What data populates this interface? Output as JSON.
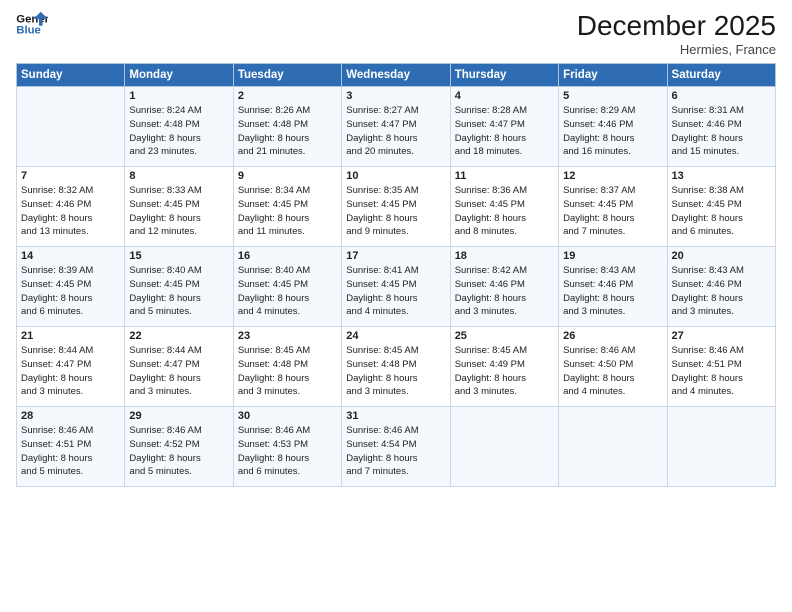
{
  "header": {
    "logo_line1": "General",
    "logo_line2": "Blue",
    "month": "December 2025",
    "location": "Hermies, France"
  },
  "columns": [
    "Sunday",
    "Monday",
    "Tuesday",
    "Wednesday",
    "Thursday",
    "Friday",
    "Saturday"
  ],
  "weeks": [
    [
      {
        "day": "",
        "sunrise": "",
        "sunset": "",
        "daylight": ""
      },
      {
        "day": "1",
        "sunrise": "Sunrise: 8:24 AM",
        "sunset": "Sunset: 4:48 PM",
        "daylight": "Daylight: 8 hours and 23 minutes."
      },
      {
        "day": "2",
        "sunrise": "Sunrise: 8:26 AM",
        "sunset": "Sunset: 4:48 PM",
        "daylight": "Daylight: 8 hours and 21 minutes."
      },
      {
        "day": "3",
        "sunrise": "Sunrise: 8:27 AM",
        "sunset": "Sunset: 4:47 PM",
        "daylight": "Daylight: 8 hours and 20 minutes."
      },
      {
        "day": "4",
        "sunrise": "Sunrise: 8:28 AM",
        "sunset": "Sunset: 4:47 PM",
        "daylight": "Daylight: 8 hours and 18 minutes."
      },
      {
        "day": "5",
        "sunrise": "Sunrise: 8:29 AM",
        "sunset": "Sunset: 4:46 PM",
        "daylight": "Daylight: 8 hours and 16 minutes."
      },
      {
        "day": "6",
        "sunrise": "Sunrise: 8:31 AM",
        "sunset": "Sunset: 4:46 PM",
        "daylight": "Daylight: 8 hours and 15 minutes."
      }
    ],
    [
      {
        "day": "7",
        "sunrise": "Sunrise: 8:32 AM",
        "sunset": "Sunset: 4:46 PM",
        "daylight": "Daylight: 8 hours and 13 minutes."
      },
      {
        "day": "8",
        "sunrise": "Sunrise: 8:33 AM",
        "sunset": "Sunset: 4:45 PM",
        "daylight": "Daylight: 8 hours and 12 minutes."
      },
      {
        "day": "9",
        "sunrise": "Sunrise: 8:34 AM",
        "sunset": "Sunset: 4:45 PM",
        "daylight": "Daylight: 8 hours and 11 minutes."
      },
      {
        "day": "10",
        "sunrise": "Sunrise: 8:35 AM",
        "sunset": "Sunset: 4:45 PM",
        "daylight": "Daylight: 8 hours and 9 minutes."
      },
      {
        "day": "11",
        "sunrise": "Sunrise: 8:36 AM",
        "sunset": "Sunset: 4:45 PM",
        "daylight": "Daylight: 8 hours and 8 minutes."
      },
      {
        "day": "12",
        "sunrise": "Sunrise: 8:37 AM",
        "sunset": "Sunset: 4:45 PM",
        "daylight": "Daylight: 8 hours and 7 minutes."
      },
      {
        "day": "13",
        "sunrise": "Sunrise: 8:38 AM",
        "sunset": "Sunset: 4:45 PM",
        "daylight": "Daylight: 8 hours and 6 minutes."
      }
    ],
    [
      {
        "day": "14",
        "sunrise": "Sunrise: 8:39 AM",
        "sunset": "Sunset: 4:45 PM",
        "daylight": "Daylight: 8 hours and 6 minutes."
      },
      {
        "day": "15",
        "sunrise": "Sunrise: 8:40 AM",
        "sunset": "Sunset: 4:45 PM",
        "daylight": "Daylight: 8 hours and 5 minutes."
      },
      {
        "day": "16",
        "sunrise": "Sunrise: 8:40 AM",
        "sunset": "Sunset: 4:45 PM",
        "daylight": "Daylight: 8 hours and 4 minutes."
      },
      {
        "day": "17",
        "sunrise": "Sunrise: 8:41 AM",
        "sunset": "Sunset: 4:45 PM",
        "daylight": "Daylight: 8 hours and 4 minutes."
      },
      {
        "day": "18",
        "sunrise": "Sunrise: 8:42 AM",
        "sunset": "Sunset: 4:46 PM",
        "daylight": "Daylight: 8 hours and 3 minutes."
      },
      {
        "day": "19",
        "sunrise": "Sunrise: 8:43 AM",
        "sunset": "Sunset: 4:46 PM",
        "daylight": "Daylight: 8 hours and 3 minutes."
      },
      {
        "day": "20",
        "sunrise": "Sunrise: 8:43 AM",
        "sunset": "Sunset: 4:46 PM",
        "daylight": "Daylight: 8 hours and 3 minutes."
      }
    ],
    [
      {
        "day": "21",
        "sunrise": "Sunrise: 8:44 AM",
        "sunset": "Sunset: 4:47 PM",
        "daylight": "Daylight: 8 hours and 3 minutes."
      },
      {
        "day": "22",
        "sunrise": "Sunrise: 8:44 AM",
        "sunset": "Sunset: 4:47 PM",
        "daylight": "Daylight: 8 hours and 3 minutes."
      },
      {
        "day": "23",
        "sunrise": "Sunrise: 8:45 AM",
        "sunset": "Sunset: 4:48 PM",
        "daylight": "Daylight: 8 hours and 3 minutes."
      },
      {
        "day": "24",
        "sunrise": "Sunrise: 8:45 AM",
        "sunset": "Sunset: 4:48 PM",
        "daylight": "Daylight: 8 hours and 3 minutes."
      },
      {
        "day": "25",
        "sunrise": "Sunrise: 8:45 AM",
        "sunset": "Sunset: 4:49 PM",
        "daylight": "Daylight: 8 hours and 3 minutes."
      },
      {
        "day": "26",
        "sunrise": "Sunrise: 8:46 AM",
        "sunset": "Sunset: 4:50 PM",
        "daylight": "Daylight: 8 hours and 4 minutes."
      },
      {
        "day": "27",
        "sunrise": "Sunrise: 8:46 AM",
        "sunset": "Sunset: 4:51 PM",
        "daylight": "Daylight: 8 hours and 4 minutes."
      }
    ],
    [
      {
        "day": "28",
        "sunrise": "Sunrise: 8:46 AM",
        "sunset": "Sunset: 4:51 PM",
        "daylight": "Daylight: 8 hours and 5 minutes."
      },
      {
        "day": "29",
        "sunrise": "Sunrise: 8:46 AM",
        "sunset": "Sunset: 4:52 PM",
        "daylight": "Daylight: 8 hours and 5 minutes."
      },
      {
        "day": "30",
        "sunrise": "Sunrise: 8:46 AM",
        "sunset": "Sunset: 4:53 PM",
        "daylight": "Daylight: 8 hours and 6 minutes."
      },
      {
        "day": "31",
        "sunrise": "Sunrise: 8:46 AM",
        "sunset": "Sunset: 4:54 PM",
        "daylight": "Daylight: 8 hours and 7 minutes."
      },
      {
        "day": "",
        "sunrise": "",
        "sunset": "",
        "daylight": ""
      },
      {
        "day": "",
        "sunrise": "",
        "sunset": "",
        "daylight": ""
      },
      {
        "day": "",
        "sunrise": "",
        "sunset": "",
        "daylight": ""
      }
    ]
  ]
}
